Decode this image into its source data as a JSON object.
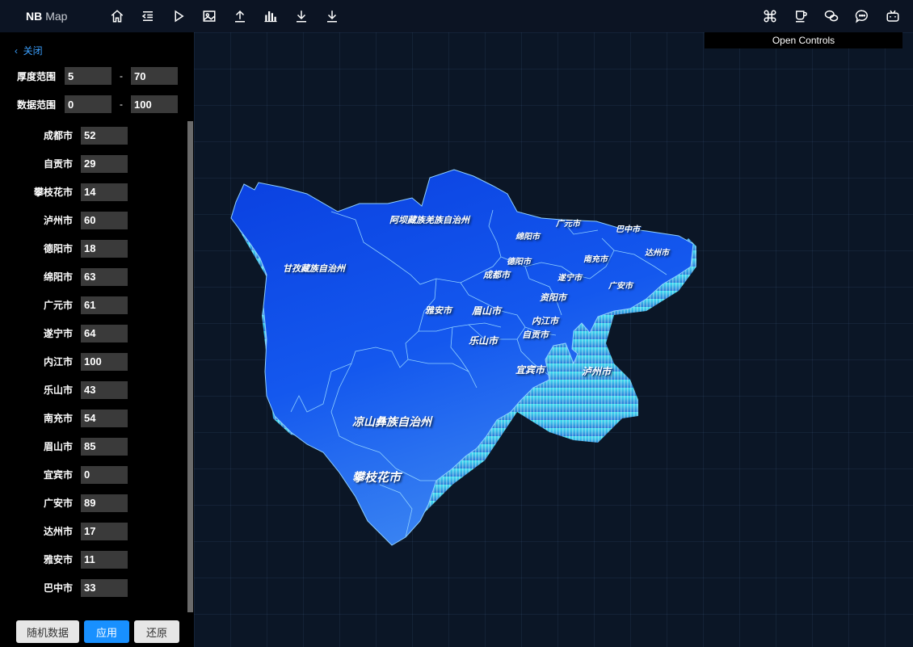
{
  "app": {
    "brand_bold": "NB",
    "brand_rest": "Map"
  },
  "toolbar": {
    "icons": [
      "home-icon",
      "outdent-icon",
      "play-icon",
      "image-icon",
      "upload-icon",
      "bar-chart-icon",
      "download-icon",
      "download-alt-icon"
    ]
  },
  "right_toolbar": {
    "icons": [
      "command-icon",
      "coffee-icon",
      "wechat-icon",
      "message-icon",
      "bilibili-icon"
    ]
  },
  "controls": {
    "label": "Open Controls"
  },
  "sidebar": {
    "close_label": "关闭",
    "thickness": {
      "label": "厚度范围",
      "min": "5",
      "max": "70"
    },
    "data_range": {
      "label": "数据范围",
      "min": "0",
      "max": "100"
    },
    "separator": "-",
    "cities": [
      {
        "name": "成都市",
        "value": "52"
      },
      {
        "name": "自贡市",
        "value": "29"
      },
      {
        "name": "攀枝花市",
        "value": "14"
      },
      {
        "name": "泸州市",
        "value": "60"
      },
      {
        "name": "德阳市",
        "value": "18"
      },
      {
        "name": "绵阳市",
        "value": "63"
      },
      {
        "name": "广元市",
        "value": "61"
      },
      {
        "name": "遂宁市",
        "value": "64"
      },
      {
        "name": "内江市",
        "value": "100"
      },
      {
        "name": "乐山市",
        "value": "43"
      },
      {
        "name": "南充市",
        "value": "54"
      },
      {
        "name": "眉山市",
        "value": "85"
      },
      {
        "name": "宜宾市",
        "value": "0"
      },
      {
        "name": "广安市",
        "value": "89"
      },
      {
        "name": "达州市",
        "value": "17"
      },
      {
        "name": "雅安市",
        "value": "11"
      },
      {
        "name": "巴中市",
        "value": "33"
      }
    ],
    "buttons": {
      "random": "随机数据",
      "apply": "应用",
      "reset": "还原"
    }
  },
  "map": {
    "labels": {
      "aba": "阿坝藏族羌族自治州",
      "ganzi": "甘孜藏族自治州",
      "liangshan": "凉山彝族自治州",
      "panzhihua": "攀枝花市",
      "guangyuan": "广元市",
      "mianyang": "绵阳市",
      "bazhong": "巴中市",
      "dazhou": "达州市",
      "deyang": "德阳市",
      "nanchong": "南充市",
      "chengdu": "成都市",
      "suining": "遂宁市",
      "guangan": "广安市",
      "ziyang": "资阳市",
      "yaan": "雅安市",
      "meishan": "眉山市",
      "neijiang": "内江市",
      "leshan": "乐山市",
      "zigong": "自贡市",
      "yibin": "宜宾市",
      "luzhou": "泸州市"
    },
    "colors": {
      "fill_dark": "#0a46e6",
      "fill_light": "#2f78f0",
      "side": "#3fd6f0",
      "border": "#7fc8ff"
    }
  }
}
